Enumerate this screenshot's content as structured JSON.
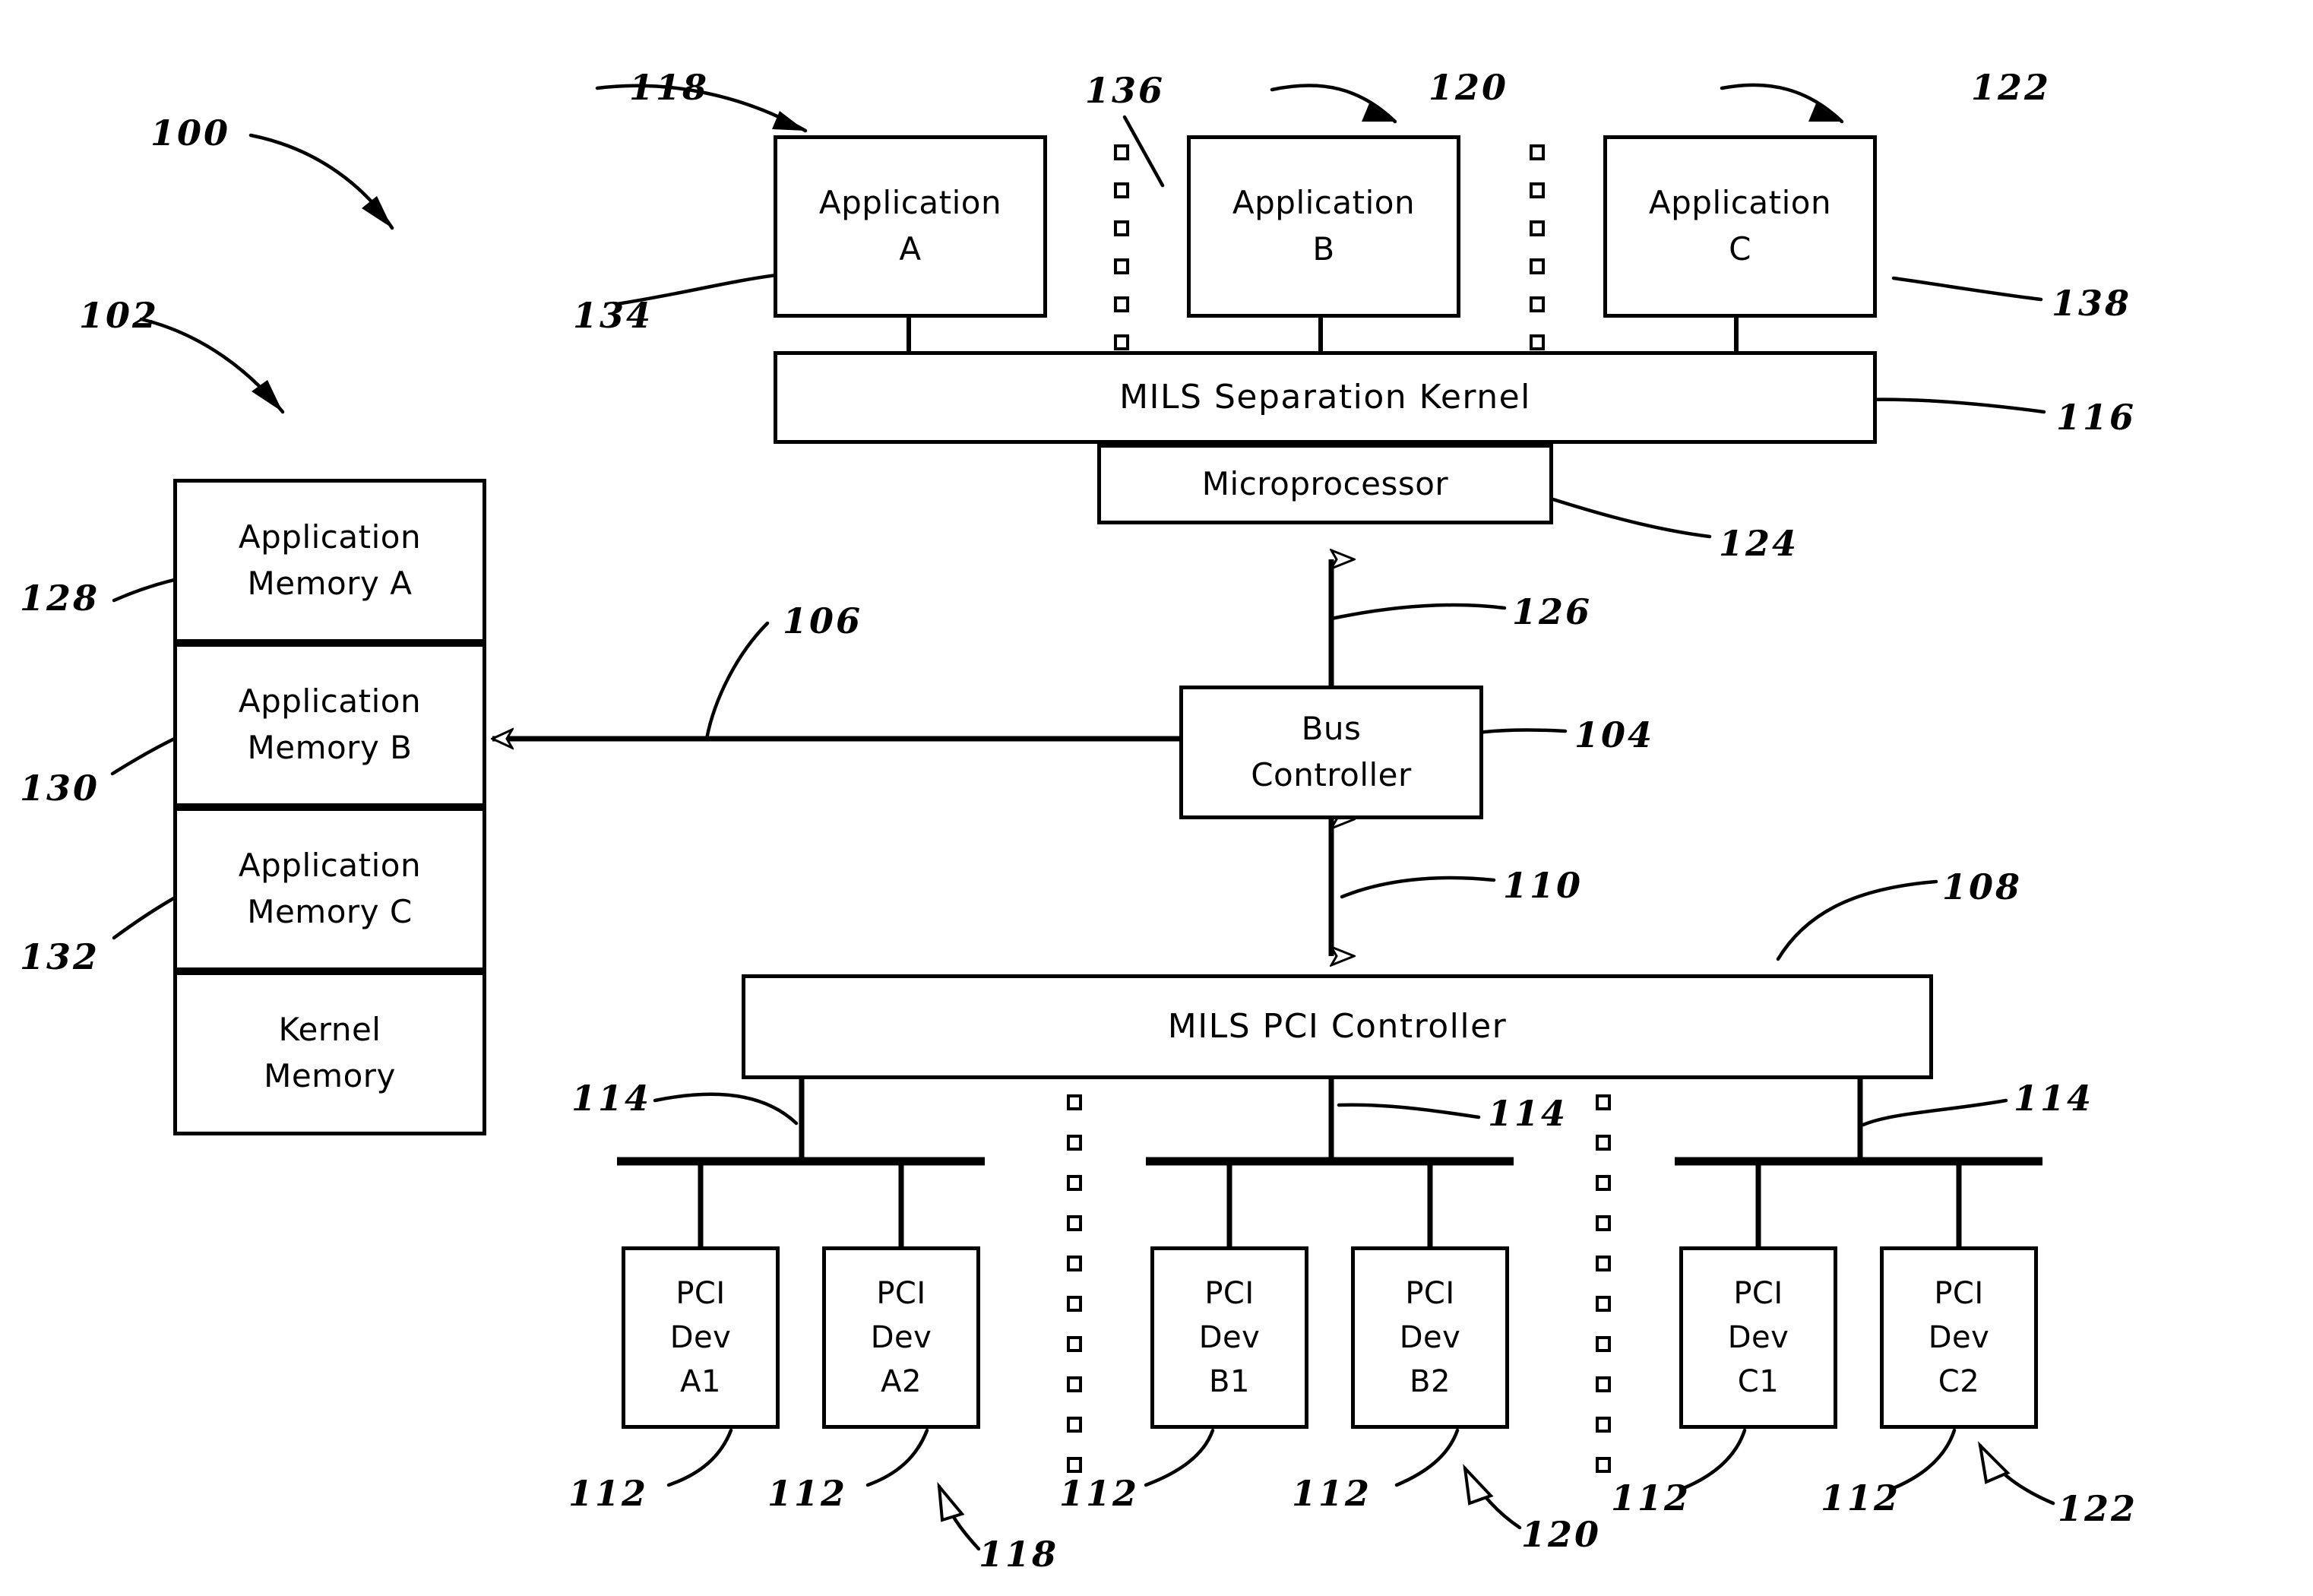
{
  "figure": {
    "title": "MILS PCI separation architecture block diagram",
    "line_color": "#000000",
    "background_color": "#ffffff"
  },
  "applications": [
    {
      "label": "Application\nA",
      "name": "application-a"
    },
    {
      "label": "Application\nB",
      "name": "application-b"
    },
    {
      "label": "Application\nC",
      "name": "application-c"
    }
  ],
  "kernel": {
    "label": "MILS Separation Kernel"
  },
  "microprocessor": {
    "label": "Microprocessor"
  },
  "bus_controller": {
    "label": "Bus\nController"
  },
  "pci_controller": {
    "label": "MILS PCI Controller"
  },
  "memory_blocks": [
    {
      "label": "Application\nMemory A"
    },
    {
      "label": "Application\nMemory B"
    },
    {
      "label": "Application\nMemory C"
    },
    {
      "label": "Kernel\nMemory"
    }
  ],
  "pci_devices": [
    {
      "label": "PCI\nDev\nA1"
    },
    {
      "label": "PCI\nDev\nA2"
    },
    {
      "label": "PCI\nDev\nB1"
    },
    {
      "label": "PCI\nDev\nB2"
    },
    {
      "label": "PCI\nDev\nC1"
    },
    {
      "label": "PCI\nDev\nC2"
    }
  ],
  "reference_numerals": {
    "r100": "100",
    "r102": "102",
    "r104": "104",
    "r106": "106",
    "r108": "108",
    "r110": "110",
    "r112_a1": "112",
    "r112_a2": "112",
    "r112_b1": "112",
    "r112_b2": "112",
    "r112_c1": "112",
    "r112_c2": "112",
    "r114_left": "114",
    "r114_mid": "114",
    "r114_right": "114",
    "r116": "116",
    "r118_top": "118",
    "r118_bottom": "118",
    "r120_top": "120",
    "r120_bottom": "120",
    "r122_top": "122",
    "r122_bottom": "122",
    "r124": "124",
    "r126": "126",
    "r128": "128",
    "r130": "130",
    "r132": "132",
    "r134": "134",
    "r136": "136",
    "r138": "138"
  }
}
